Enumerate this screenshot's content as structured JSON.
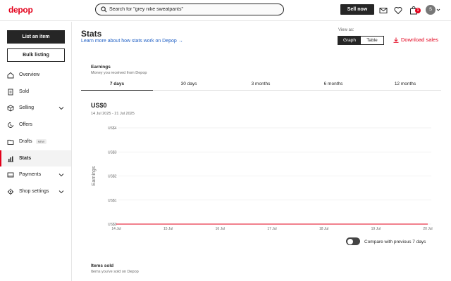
{
  "header": {
    "logo": "depop",
    "search_value": "Search for \"grey nike sweatpants\"",
    "sell_now": "Sell now",
    "cart_count": "1",
    "avatar_initial": "S"
  },
  "sidebar": {
    "list_item": "List an item",
    "bulk_listing": "Bulk listing",
    "items": [
      {
        "label": "Overview",
        "icon": "home-icon"
      },
      {
        "label": "Sold",
        "icon": "receipt-icon"
      },
      {
        "label": "Selling",
        "icon": "box-icon"
      },
      {
        "label": "Offers",
        "icon": "offers-icon"
      },
      {
        "label": "Drafts",
        "icon": "folder-icon",
        "badge": "NEW"
      },
      {
        "label": "Stats",
        "icon": "bar-chart-icon"
      },
      {
        "label": "Payments",
        "icon": "wallet-icon"
      },
      {
        "label": "Shop settings",
        "icon": "gear-icon"
      }
    ]
  },
  "main": {
    "title": "Stats",
    "learn_link": "Learn more about how stats work on Depop",
    "view_as": "View as:",
    "view_options": [
      "Graph",
      "Table"
    ],
    "download": "Download sales",
    "earnings": {
      "title": "Earnings",
      "subtitle": "Money you received from Depop",
      "tabs": [
        "7 days",
        "30 days",
        "3 months",
        "6 months",
        "12 months"
      ],
      "amount": "US$0",
      "range": "14 Jul 2025 - 21 Jul 2025"
    },
    "compare_label": "Compare with previous 7 days",
    "items_sold": {
      "title": "Items sold",
      "subtitle": "Items you've sold on Depop"
    }
  },
  "colors": {
    "brand": "#e3001b",
    "dark": "#262626",
    "link": "#1f5fc4"
  },
  "chart_data": {
    "type": "line",
    "ylabel": "Earnings",
    "x": [
      "14 Jul",
      "15 Jul",
      "16 Jul",
      "17 Jul",
      "18 Jul",
      "19 Jul",
      "20 Jul"
    ],
    "y_ticks": [
      "US$0",
      "US$1",
      "US$2",
      "US$3",
      "US$4"
    ],
    "series": [
      {
        "values": [
          0,
          0,
          0,
          0,
          0,
          0,
          0
        ]
      }
    ],
    "ylim": [
      0,
      4
    ],
    "grid": true
  }
}
